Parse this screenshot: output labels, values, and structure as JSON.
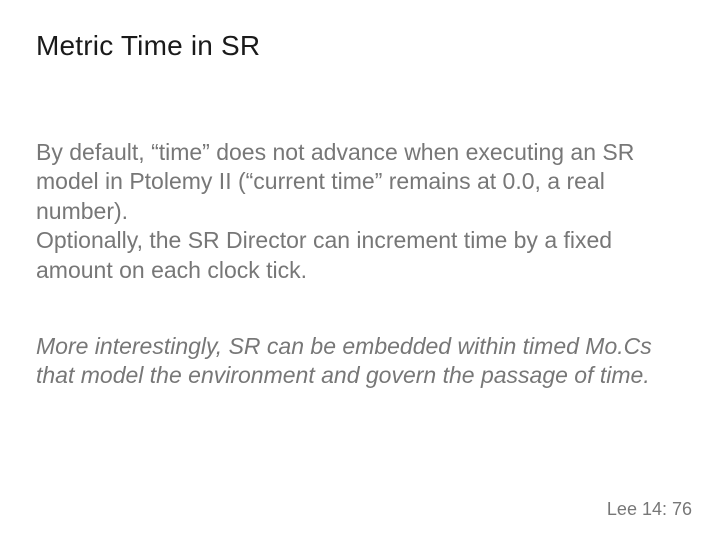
{
  "title": "Metric Time in SR",
  "paragraph1": "By default, “time” does not advance when executing an SR model in Ptolemy II (“current time” remains at 0.0, a real number).\nOptionally, the SR Director can increment time by a fixed amount on each clock tick.",
  "paragraph2": "More interestingly, SR can be embedded within timed Mo.Cs that model the environment and govern the passage of time.",
  "footer": "Lee 14: 76"
}
